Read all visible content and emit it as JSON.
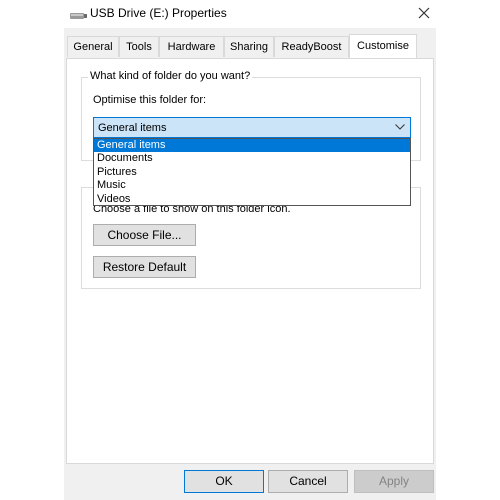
{
  "window": {
    "title": "USB Drive (E:) Properties",
    "close_icon": "close-icon",
    "drive_icon": "usb-drive-icon"
  },
  "tabs": [
    {
      "label": "General"
    },
    {
      "label": "Tools"
    },
    {
      "label": "Hardware"
    },
    {
      "label": "Sharing"
    },
    {
      "label": "ReadyBoost"
    },
    {
      "label": "Customise",
      "active": true
    }
  ],
  "folder_type_group": {
    "caption": "What kind of folder do you want?",
    "optimise_label": "Optimise this folder for:",
    "selected_value": "General items",
    "options": [
      "General items",
      "Documents",
      "Pictures",
      "Music",
      "Videos"
    ]
  },
  "folder_icon_group": {
    "caption_fragment": "Choose a file to show on this folder icon.",
    "choose_file_label": "Choose File...",
    "restore_default_label": "Restore Default"
  },
  "buttons": {
    "ok": "OK",
    "cancel": "Cancel",
    "apply": "Apply"
  },
  "colors": {
    "accent": "#0078d7",
    "selection_bg": "#cce4f7",
    "dialog_bg": "#f0f0f0"
  }
}
